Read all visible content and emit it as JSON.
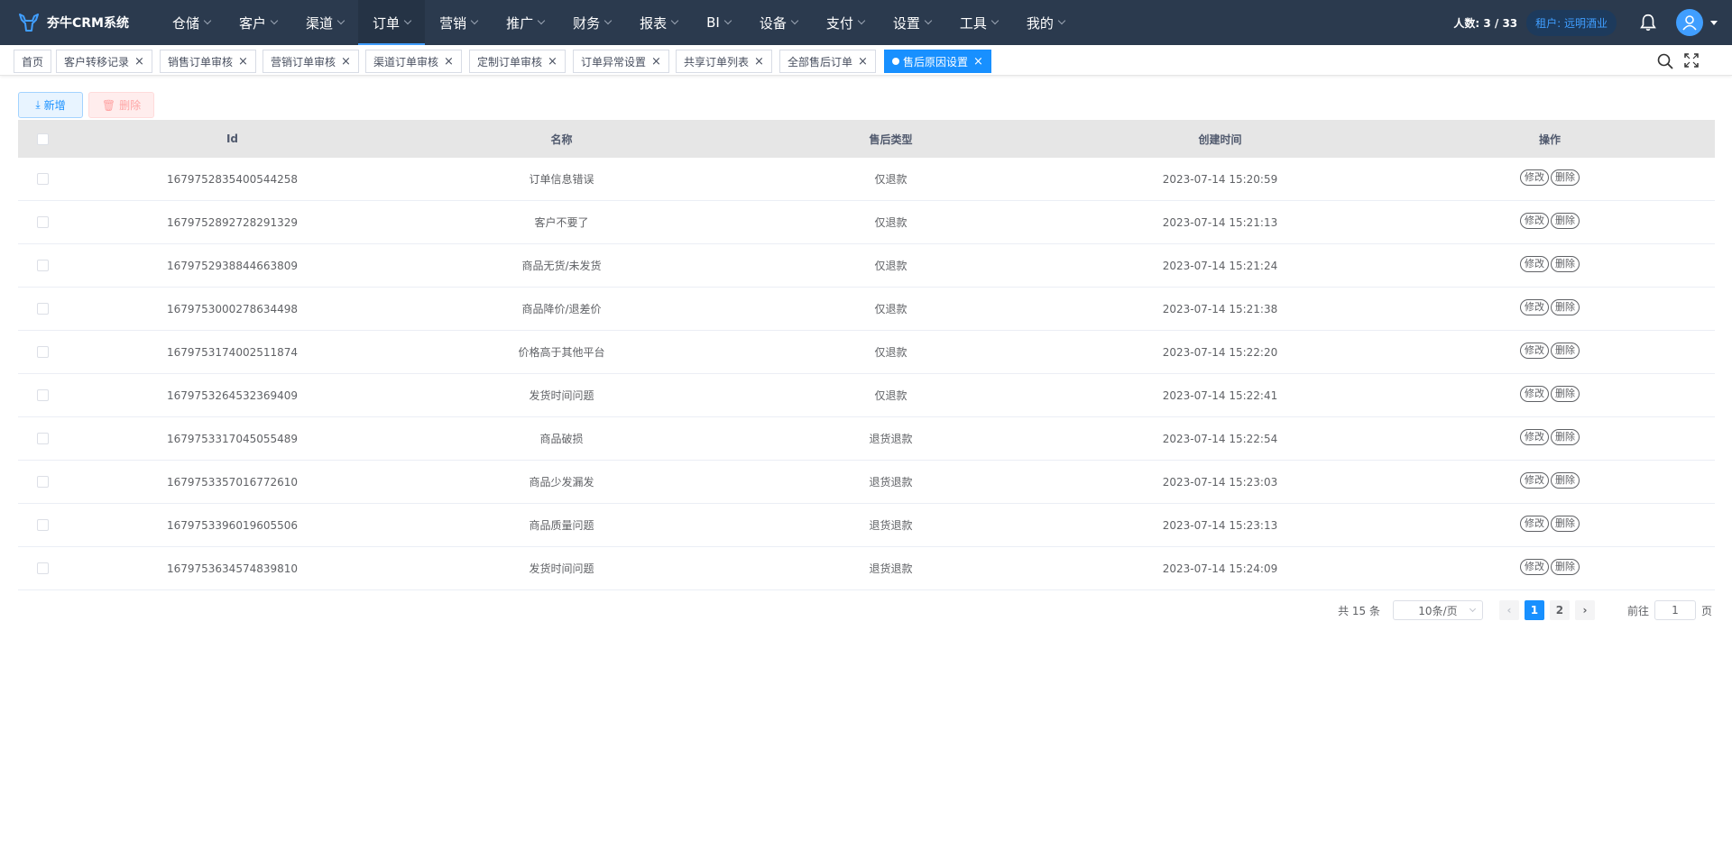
{
  "app": {
    "title": "夯牛CRM系统"
  },
  "menu": [
    {
      "label": "仓储",
      "active": false
    },
    {
      "label": "客户",
      "active": false
    },
    {
      "label": "渠道",
      "active": false
    },
    {
      "label": "订单",
      "active": true
    },
    {
      "label": "营销",
      "active": false
    },
    {
      "label": "推广",
      "active": false
    },
    {
      "label": "财务",
      "active": false
    },
    {
      "label": "报表",
      "active": false
    },
    {
      "label": "BI",
      "active": false
    },
    {
      "label": "设备",
      "active": false
    },
    {
      "label": "支付",
      "active": false
    },
    {
      "label": "设置",
      "active": false
    },
    {
      "label": "工具",
      "active": false
    },
    {
      "label": "我的",
      "active": false
    }
  ],
  "header": {
    "people": "人数: 3 / 33",
    "tenant": "租户: 远明酒业",
    "icons": [
      "bell-icon",
      "user-avatar-icon"
    ]
  },
  "tabs": [
    {
      "label": "首页",
      "closable": false,
      "active": false
    },
    {
      "label": "客户转移记录",
      "closable": true,
      "active": false
    },
    {
      "label": "销售订单审核",
      "closable": true,
      "active": false
    },
    {
      "label": "营销订单审核",
      "closable": true,
      "active": false
    },
    {
      "label": "渠道订单审核",
      "closable": true,
      "active": false
    },
    {
      "label": "定制订单审核",
      "closable": true,
      "active": false
    },
    {
      "label": "订单异常设置",
      "closable": true,
      "active": false
    },
    {
      "label": "共享订单列表",
      "closable": true,
      "active": false
    },
    {
      "label": "全部售后订单",
      "closable": true,
      "active": false
    },
    {
      "label": "售后原因设置",
      "closable": true,
      "active": true
    }
  ],
  "toolbar": {
    "add_label": "新增",
    "delete_label": "删除"
  },
  "table": {
    "columns": [
      "Id",
      "名称",
      "售后类型",
      "创建时间",
      "操作"
    ],
    "rows": [
      {
        "id": "1679752835400544258",
        "name": "订单信息错误",
        "type": "仅退款",
        "created": "2023-07-14 15:20:59"
      },
      {
        "id": "1679752892728291329",
        "name": "客户不要了",
        "type": "仅退款",
        "created": "2023-07-14 15:21:13"
      },
      {
        "id": "1679752938844663809",
        "name": "商品无货/未发货",
        "type": "仅退款",
        "created": "2023-07-14 15:21:24"
      },
      {
        "id": "1679753000278634498",
        "name": "商品降价/退差价",
        "type": "仅退款",
        "created": "2023-07-14 15:21:38"
      },
      {
        "id": "1679753174002511874",
        "name": "价格高于其他平台",
        "type": "仅退款",
        "created": "2023-07-14 15:22:20"
      },
      {
        "id": "1679753264532369409",
        "name": "发货时间问题",
        "type": "仅退款",
        "created": "2023-07-14 15:22:41"
      },
      {
        "id": "1679753317045055489",
        "name": "商品破损",
        "type": "退货退款",
        "created": "2023-07-14 15:22:54"
      },
      {
        "id": "1679753357016772610",
        "name": "商品少发漏发",
        "type": "退货退款",
        "created": "2023-07-14 15:23:03"
      },
      {
        "id": "1679753396019605506",
        "name": "商品质量问题",
        "type": "退货退款",
        "created": "2023-07-14 15:23:13"
      },
      {
        "id": "1679753634574839810",
        "name": "发货时间问题",
        "type": "退货退款",
        "created": "2023-07-14 15:24:09"
      }
    ],
    "edit_label": "修改",
    "delete_label": "删除"
  },
  "pagination": {
    "total": "共 15 条",
    "page_size": "10条/页",
    "pages": [
      "1",
      "2"
    ],
    "current": "1",
    "goto_prefix": "前往",
    "goto_value": "1",
    "goto_suffix": "页"
  },
  "colors": {
    "nav_bg": "#2b3a4e",
    "accent": "#1890ff",
    "danger": "#ffa4a4"
  }
}
